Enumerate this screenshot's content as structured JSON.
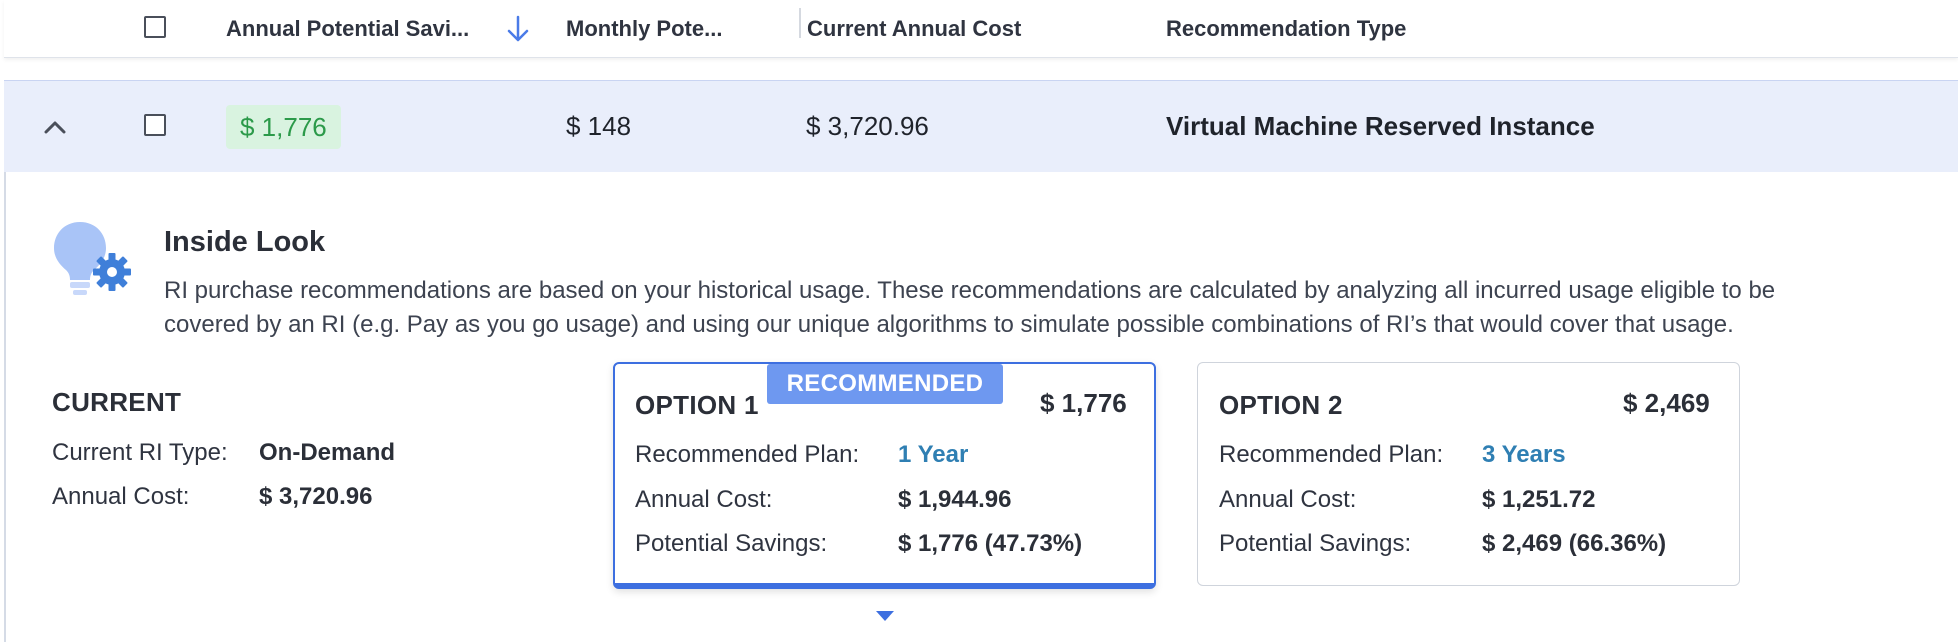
{
  "header": {
    "col_annual": "Annual Potential Savi...",
    "col_monthly": "Monthly Pote...",
    "col_current": "Current Annual Cost",
    "col_type": "Recommendation Type"
  },
  "row": {
    "annual_savings": "$ 1,776",
    "monthly": "$ 148",
    "current_cost": "$ 3,720.96",
    "type": "Virtual Machine Reserved Instance"
  },
  "inside_look": {
    "title": "Inside Look",
    "line1": "RI purchase recommendations are based on your historical usage. These recommendations are calculated by analyzing all incurred usage eligible to be",
    "line2": "covered by an RI (e.g. Pay as you go usage) and using our unique algorithms to simulate possible combinations of RI’s that would cover that usage."
  },
  "current": {
    "title": "CURRENT",
    "ri_type_label": "Current RI Type:",
    "ri_type_value": "On-Demand",
    "annual_cost_label": "Annual Cost:",
    "annual_cost_value": "$ 3,720.96"
  },
  "option1": {
    "badge": "RECOMMENDED",
    "title": "OPTION 1",
    "amount": "$ 1,776",
    "plan_label": "Recommended Plan:",
    "plan_value": "1 Year",
    "cost_label": "Annual Cost:",
    "cost_value": "$ 1,944.96",
    "savings_label": "Potential Savings:",
    "savings_value": "$ 1,776 (47.73%)"
  },
  "option2": {
    "title": "OPTION 2",
    "amount": "$ 2,469",
    "plan_label": "Recommended Plan:",
    "plan_value": "3 Years",
    "cost_label": "Annual Cost:",
    "cost_value": "$ 1,251.72",
    "savings_label": "Potential Savings:",
    "savings_value": "$ 2,469 (66.36%)"
  },
  "colors": {
    "accent": "#3d6fe0",
    "savings_green": "#2c9a4a",
    "link_blue": "#2f7fb3",
    "row_bg": "#e9eefb"
  }
}
